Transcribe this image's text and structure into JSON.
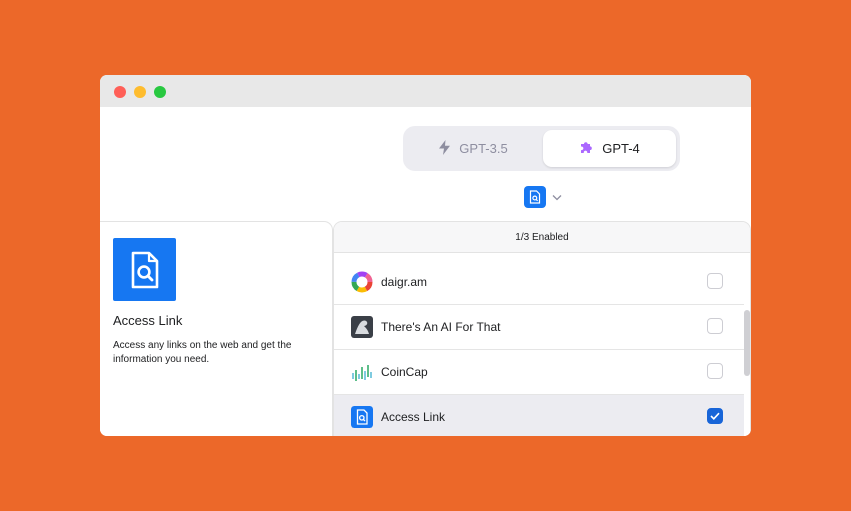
{
  "window": {
    "controls": [
      "close",
      "minimize",
      "zoom"
    ]
  },
  "model_switcher": {
    "options": [
      {
        "label": "GPT-3.5",
        "icon": "lightning-icon",
        "selected": false
      },
      {
        "label": "GPT-4",
        "icon": "puzzle-icon",
        "selected": true
      }
    ]
  },
  "plugin_selector": {
    "icon": "access-link-icon",
    "chevron": "chevron-down-icon"
  },
  "detail": {
    "title": "Access Link",
    "description": "Access any links on the web and get the information you need.",
    "icon": "access-link-icon"
  },
  "plugin_list": {
    "status": "1/3 Enabled",
    "items": [
      {
        "label": "daigr.am",
        "icon": "daigram-logo-icon",
        "checked": false
      },
      {
        "label": "There's An AI For That",
        "icon": "aiforthat-logo-icon",
        "checked": false
      },
      {
        "label": "CoinCap",
        "icon": "coincap-logo-icon",
        "checked": false
      },
      {
        "label": "Access Link",
        "icon": "access-link-icon",
        "checked": true
      }
    ]
  },
  "colors": {
    "background": "#EC6829",
    "accent": "#1677F2",
    "checkbox_on": "#1865D8"
  }
}
